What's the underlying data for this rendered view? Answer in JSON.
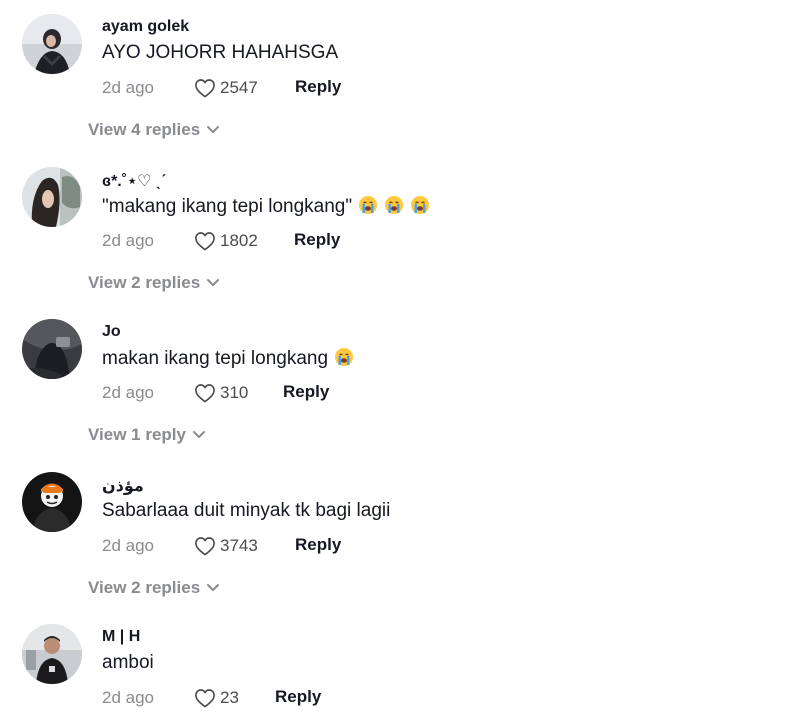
{
  "comments": [
    {
      "username": "ayam  golek",
      "text": "AYO JOHORR HAHAHSGA",
      "date": "2d ago",
      "likes": "2547",
      "reply_label": "Reply",
      "view_replies": "View 4 replies",
      "emoji_count": 0
    },
    {
      "username": "ɞ*.˚⋆♡ ˎˊ",
      "text": "\"makang ikang tepi longkang\"",
      "date": "2d ago",
      "likes": "1802",
      "reply_label": "Reply",
      "view_replies": "View 2 replies",
      "emoji_count": 3
    },
    {
      "username": "Jo",
      "text": "makan ikang tepi longkang",
      "date": "2d ago",
      "likes": "310",
      "reply_label": "Reply",
      "view_replies": "View 1 reply",
      "emoji_count": 1
    },
    {
      "username": "مؤذن",
      "text": "Sabarlaaa duit minyak tk bagi lagii",
      "date": "2d ago",
      "likes": "3743",
      "reply_label": "Reply",
      "view_replies": "View 2 replies",
      "emoji_count": 0
    },
    {
      "username": "M | H",
      "text": "amboi",
      "date": "2d ago",
      "likes": "23",
      "reply_label": "Reply",
      "emoji_count": 0
    }
  ],
  "icons": {
    "like": "heart-outline-icon",
    "expand": "chevron-down-icon",
    "emoji": "loudly-crying-face-emoji"
  },
  "colors": {
    "primary_text": "#161823",
    "secondary_text": "#8a8b91",
    "emoji_face": "#ffc83d",
    "emoji_tears": "#4aa3e8"
  }
}
